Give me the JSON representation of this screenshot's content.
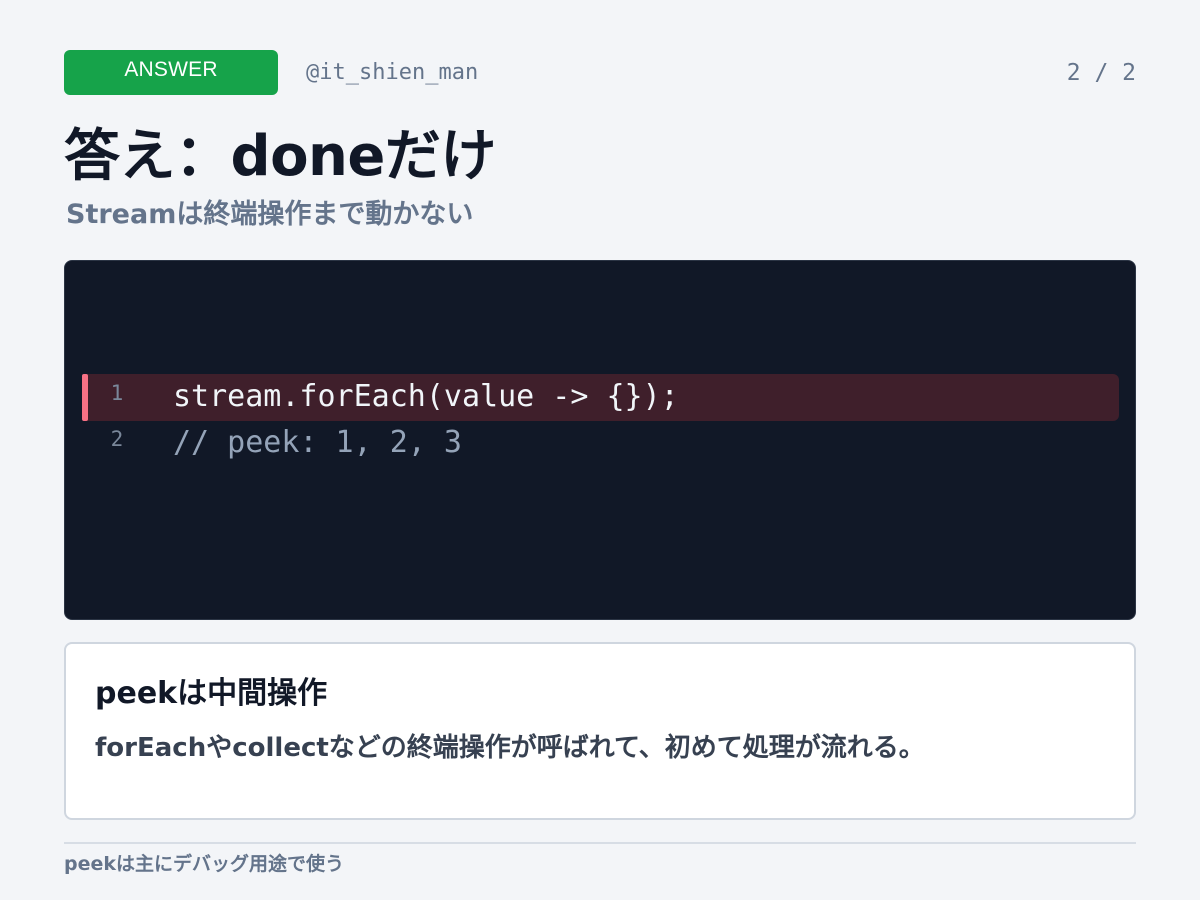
{
  "header": {
    "badge": "ANSWER",
    "handle": "@it_shien_man",
    "page_counter": "2 / 2"
  },
  "title": "答え：doneだけ",
  "subtitle": "Streamは終端操作まで動かない",
  "code": {
    "lines": [
      {
        "number": "1",
        "text": "stream.forEach(value -> {});",
        "highlighted": true
      },
      {
        "number": "2",
        "text": "// peek: 1, 2, 3",
        "highlighted": false
      }
    ]
  },
  "note": {
    "heading": "peekは中間操作",
    "body": "forEachやcollectなどの終端操作が呼ばれて、初めて処理が流れる。"
  },
  "footer": {
    "note": "peekは主にデバッグ用途で使う"
  },
  "colors": {
    "badge_bg": "#16a34a",
    "code_bg": "#111827",
    "highlight_bg": "#3f1f2b",
    "highlight_marker": "#f87185",
    "muted_text": "#64748b"
  }
}
